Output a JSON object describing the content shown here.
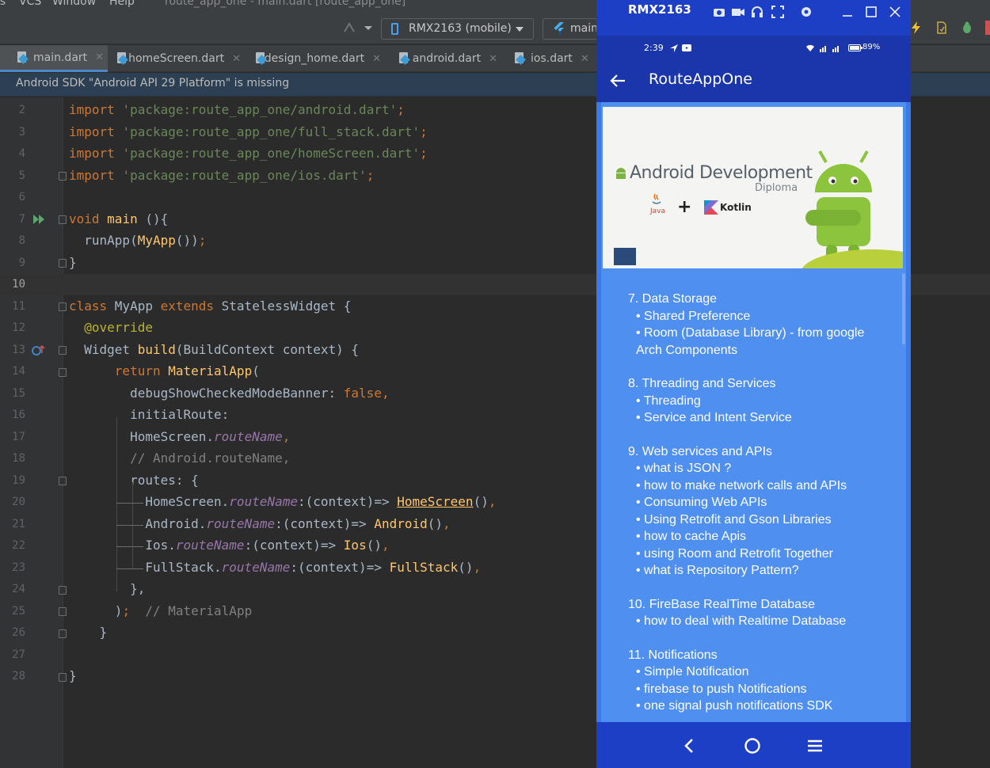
{
  "menu": {
    "items": [
      "ls",
      "VCS",
      "Window",
      "Help"
    ],
    "title": "route_app_one - main.dart [route_app_one]"
  },
  "toolbar": {
    "device": "RMX2163 (mobile)",
    "run_config": "main"
  },
  "tabs": [
    {
      "label": "main.dart",
      "active": true
    },
    {
      "label": "homeScreen.dart",
      "active": false
    },
    {
      "label": "design_home.dart",
      "active": false
    },
    {
      "label": "android.dart",
      "active": false
    },
    {
      "label": "ios.dart",
      "active": false
    }
  ],
  "banner": {
    "text": "Android SDK \"Android API 29 Platform\" is missing"
  },
  "editor": {
    "current_line": 10,
    "lines": [
      {
        "n": "2",
        "parts": [
          [
            "kw",
            "import "
          ],
          [
            "str",
            "'package:route_app_one/android.dart'"
          ],
          [
            "kw",
            ";"
          ]
        ]
      },
      {
        "n": "3",
        "parts": [
          [
            "kw",
            "import "
          ],
          [
            "str",
            "'package:route_app_one/full_stack.dart'"
          ],
          [
            "kw",
            ";"
          ]
        ]
      },
      {
        "n": "4",
        "parts": [
          [
            "kw",
            "import "
          ],
          [
            "str",
            "'package:route_app_one/homeScreen.dart'"
          ],
          [
            "kw",
            ";"
          ]
        ]
      },
      {
        "n": "5",
        "parts": [
          [
            "kw",
            "import "
          ],
          [
            "str",
            "'package:route_app_one/ios.dart'"
          ],
          [
            "kw",
            ";"
          ]
        ]
      },
      {
        "n": "6",
        "parts": []
      },
      {
        "n": "7",
        "parts": [
          [
            "kw",
            "void "
          ],
          [
            "fn",
            "main "
          ],
          [
            "txt",
            "(){"
          ]
        ]
      },
      {
        "n": "8",
        "parts": [
          [
            "txt",
            "  runApp("
          ],
          [
            "fn",
            "MyApp"
          ],
          [
            "txt",
            "())"
          ],
          [
            "kw",
            ";"
          ]
        ]
      },
      {
        "n": "9",
        "parts": [
          [
            "txt",
            "}"
          ]
        ]
      },
      {
        "n": "10",
        "parts": []
      },
      {
        "n": "11",
        "parts": [
          [
            "kw",
            "class "
          ],
          [
            "txt",
            "MyApp "
          ],
          [
            "kw",
            "extends "
          ],
          [
            "txt",
            "StatelessWidget {"
          ]
        ]
      },
      {
        "n": "12",
        "parts": [
          [
            "ann",
            "  @override"
          ]
        ]
      },
      {
        "n": "13",
        "parts": [
          [
            "txt",
            "  Widget "
          ],
          [
            "fn",
            "build"
          ],
          [
            "txt",
            "(BuildContext context) {"
          ]
        ]
      },
      {
        "n": "14",
        "parts": [
          [
            "kw",
            "      return "
          ],
          [
            "fn",
            "MaterialApp"
          ],
          [
            "txt",
            "("
          ]
        ]
      },
      {
        "n": "15",
        "parts": [
          [
            "txt",
            "        debugShowCheckedModeBanner: "
          ],
          [
            "kw",
            "false,"
          ]
        ]
      },
      {
        "n": "16",
        "parts": [
          [
            "txt",
            "        initialRoute:"
          ]
        ]
      },
      {
        "n": "17",
        "parts": [
          [
            "txt",
            "        HomeScreen."
          ],
          [
            "ital",
            "routeName"
          ],
          [
            "kw",
            ","
          ]
        ]
      },
      {
        "n": "18",
        "parts": [
          [
            "cmt",
            "        // Android.routeName,"
          ]
        ]
      },
      {
        "n": "19",
        "parts": [
          [
            "txt",
            "        routes: {"
          ]
        ]
      },
      {
        "n": "20",
        "parts": [
          [
            "txt",
            "          HomeScreen."
          ],
          [
            "ital",
            "routeName"
          ],
          [
            "txt",
            ":(context)=> "
          ],
          [
            "fnu",
            "HomeScreen"
          ],
          [
            "txt",
            "()"
          ],
          [
            "kw",
            ","
          ]
        ]
      },
      {
        "n": "21",
        "parts": [
          [
            "txt",
            "          Android."
          ],
          [
            "ital",
            "routeName"
          ],
          [
            "txt",
            ":(context)=> "
          ],
          [
            "fn",
            "Android"
          ],
          [
            "txt",
            "()"
          ],
          [
            "kw",
            ","
          ]
        ]
      },
      {
        "n": "22",
        "parts": [
          [
            "txt",
            "          Ios."
          ],
          [
            "ital",
            "routeName"
          ],
          [
            "txt",
            ":(context)=> "
          ],
          [
            "fn",
            "Ios"
          ],
          [
            "txt",
            "()"
          ],
          [
            "kw",
            ","
          ]
        ]
      },
      {
        "n": "23",
        "parts": [
          [
            "txt",
            "          FullStack."
          ],
          [
            "ital",
            "routeName"
          ],
          [
            "txt",
            ":(context)=> "
          ],
          [
            "fn",
            "FullStack"
          ],
          [
            "txt",
            "()"
          ],
          [
            "kw",
            ","
          ]
        ]
      },
      {
        "n": "24",
        "parts": [
          [
            "txt",
            "        },"
          ]
        ]
      },
      {
        "n": "25",
        "parts": [
          [
            "txt",
            "      )"
          ],
          [
            "kw",
            ";"
          ],
          [
            "cmt",
            "  // MaterialApp"
          ]
        ]
      },
      {
        "n": "26",
        "parts": [
          [
            "txt",
            "    }"
          ]
        ]
      },
      {
        "n": "27",
        "parts": []
      },
      {
        "n": "28",
        "parts": [
          [
            "txt",
            "}"
          ]
        ]
      }
    ]
  },
  "emulator": {
    "window_title": "RMX2163",
    "status_time": "2:39",
    "battery": "89%",
    "app_title": "RouteAppOne",
    "hero": {
      "line1": "Android Development",
      "line2": "Diploma",
      "java": "Java",
      "plus": "+",
      "kotlin": "Kotlin"
    },
    "course_lines": [
      {
        "text": "7.  Data Storage",
        "sub": false
      },
      {
        "text": "• Shared Preference",
        "sub": true
      },
      {
        "text": "• Room (Database Library) - from google",
        "sub": true
      },
      {
        "text": "Arch Components",
        "sub": true
      },
      {
        "text": "",
        "sub": false
      },
      {
        "text": "8.  Threading and Services",
        "sub": false
      },
      {
        "text": "• Threading",
        "sub": true
      },
      {
        "text": "• Service and Intent Service",
        "sub": true
      },
      {
        "text": "",
        "sub": false
      },
      {
        "text": "9.  Web services and APIs",
        "sub": false
      },
      {
        "text": "• what is JSON ?",
        "sub": true
      },
      {
        "text": "• how to make network calls and APIs",
        "sub": true
      },
      {
        "text": "• Consuming Web APIs",
        "sub": true
      },
      {
        "text": "• Using Retrofit and Gson Libraries",
        "sub": true
      },
      {
        "text": "• how to cache Apis",
        "sub": true
      },
      {
        "text": "• using Room and Retrofit Together",
        "sub": true
      },
      {
        "text": "• what is Repository Pattern?",
        "sub": true
      },
      {
        "text": "",
        "sub": false
      },
      {
        "text": "10.  FireBase RealTime Database",
        "sub": false
      },
      {
        "text": "• how to deal with Realtime Database",
        "sub": true
      },
      {
        "text": "",
        "sub": false
      },
      {
        "text": "11.  Notifications",
        "sub": false
      },
      {
        "text": "• Simple Notification",
        "sub": true
      },
      {
        "text": "• firebase to push Notifications",
        "sub": true
      },
      {
        "text": "• one signal push notifications SDK",
        "sub": true
      }
    ]
  }
}
